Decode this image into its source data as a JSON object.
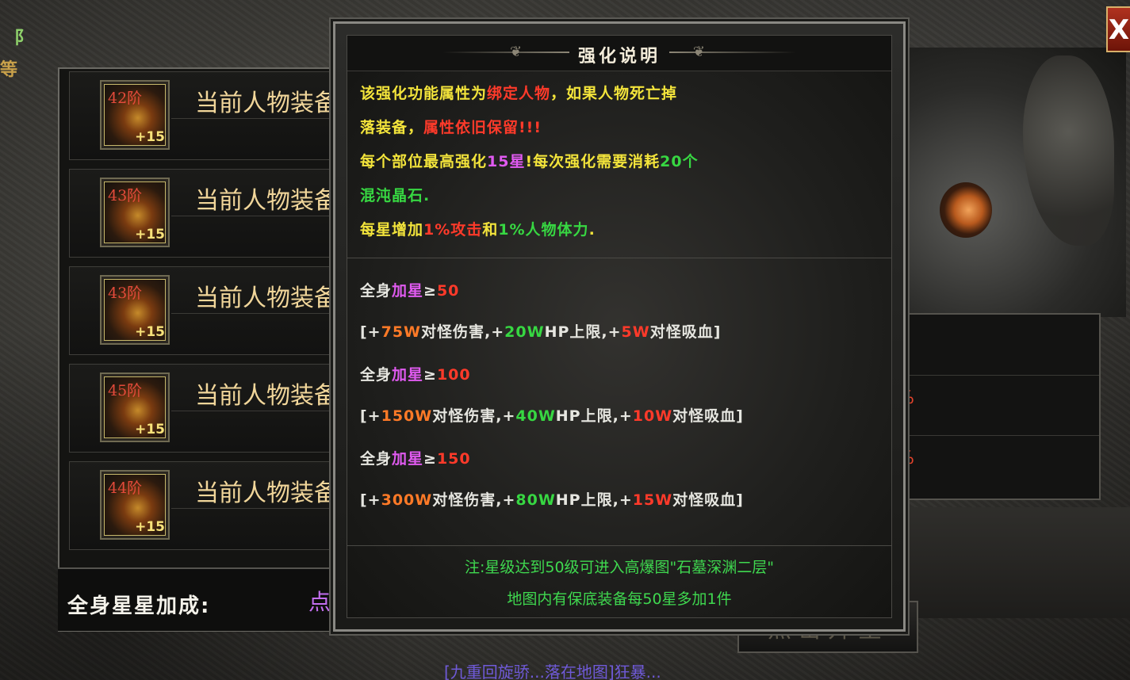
{
  "window": {
    "close_glyph": "X",
    "corner_glyph": "阝",
    "corner_glyph2": "等"
  },
  "equipment": [
    {
      "tier": "42阶",
      "plus": "+15",
      "name": "当前人物装备"
    },
    {
      "tier": "43阶",
      "plus": "+15",
      "name": "当前人物装备"
    },
    {
      "tier": "43阶",
      "plus": "+15",
      "name": "当前人物装备"
    },
    {
      "tier": "45阶",
      "plus": "+15",
      "name": "当前人物装备"
    },
    {
      "tier": "44阶",
      "plus": "+15",
      "name": "当前人物装备"
    }
  ],
  "bonus": {
    "label": "全身星星加成:",
    "cut_text": "点"
  },
  "right_panel": {
    "pct1": "%",
    "pct2": "%",
    "star_button": "点击升星"
  },
  "bottom_strip": "[九重回旋骄...落在地图]狂暴...",
  "popup": {
    "title": "强化说明",
    "desc": {
      "l1_a": "该强化功能属性为",
      "l1_b": "绑定人物",
      "l1_c": "，如果人物死亡掉",
      "l2_a": "落装备，",
      "l2_b": "属性依旧保留!!!",
      "l3_a": "每个部位最高强化",
      "l3_b": "15星",
      "l3_c": "!每次强化需要消耗",
      "l3_d": "20个",
      "l4_a": "混沌晶石.",
      "l5_a": "每星增加",
      "l5_b": "1%攻击",
      "l5_c": "和",
      "l5_d": "1%人物体力",
      "l5_e": "."
    },
    "tiers": [
      {
        "pre": "全身",
        "mid": "加星",
        "ge": "≥",
        "num": "50",
        "b1": "[+",
        "dmg": "75W",
        "t1": "对怪伤害,+",
        "hp": "20W",
        "t2": "HP上限,+",
        "ls": "5W",
        "t3": "对怪吸血]"
      },
      {
        "pre": "全身",
        "mid": "加星",
        "ge": "≥",
        "num": "100",
        "b1": "[+",
        "dmg": "150W",
        "t1": "对怪伤害,+",
        "hp": "40W",
        "t2": "HP上限,+",
        "ls": "10W",
        "t3": "对怪吸血]"
      },
      {
        "pre": "全身",
        "mid": "加星",
        "ge": "≥",
        "num": "150",
        "b1": "[+",
        "dmg": "300W",
        "t1": "对怪伤害,+",
        "hp": "80W",
        "t2": "HP上限,+",
        "ls": "15W",
        "t3": "对怪吸血]"
      }
    ],
    "note_line1": "注:星级达到50级可进入高爆图\"石墓深渊二层\"",
    "note_line2": "地图内有保底装备每50星多加1件"
  },
  "colors": {
    "yellow": "#f3e43b",
    "red": "#ff3a2a",
    "green": "#37d742",
    "magenta": "#e05af0",
    "orange": "#ff7a27",
    "gold_text": "#f1d69a"
  }
}
